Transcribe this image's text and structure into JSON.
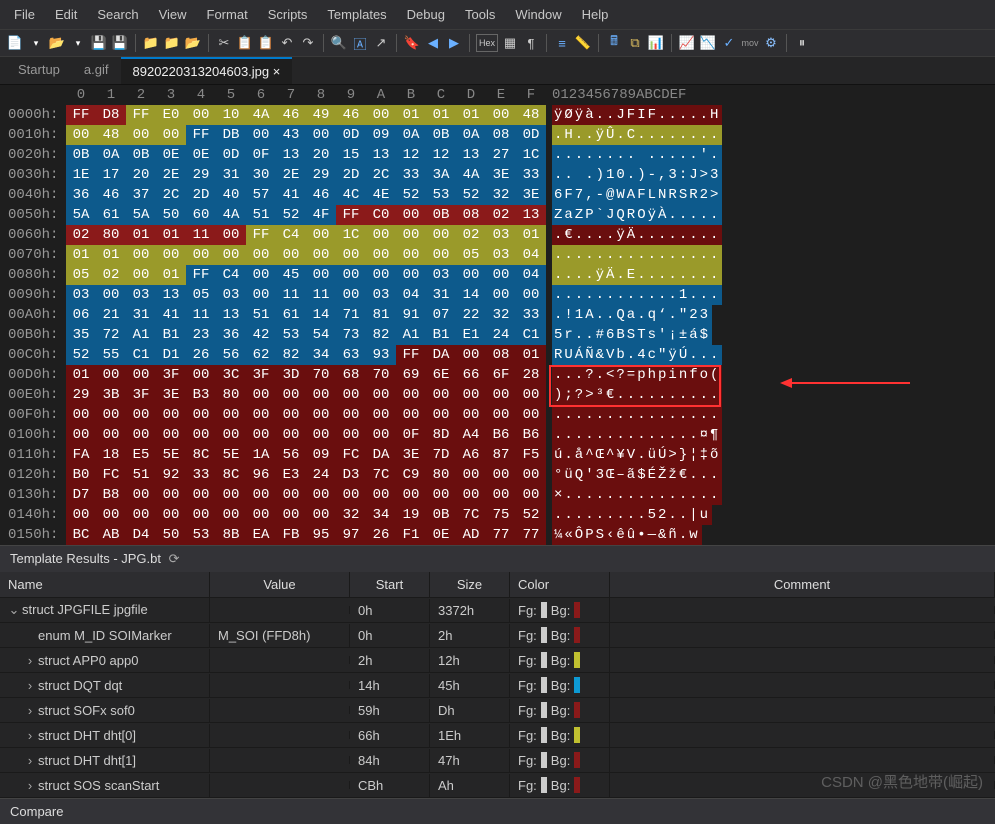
{
  "menu": [
    "File",
    "Edit",
    "Search",
    "View",
    "Format",
    "Scripts",
    "Templates",
    "Debug",
    "Tools",
    "Window",
    "Help"
  ],
  "tabs": [
    {
      "label": "Startup",
      "active": false
    },
    {
      "label": "a.gif",
      "active": false
    },
    {
      "label": "8920220313204603.jpg",
      "active": true
    }
  ],
  "hex": {
    "cols": [
      "0",
      "1",
      "2",
      "3",
      "4",
      "5",
      "6",
      "7",
      "8",
      "9",
      "A",
      "B",
      "C",
      "D",
      "E",
      "F"
    ],
    "ascii_header": "0123456789ABCDEF",
    "rows": [
      {
        "off": "0000h:",
        "b": [
          "FF",
          "D8",
          "FF",
          "E0",
          "00",
          "10",
          "4A",
          "46",
          "49",
          "46",
          "00",
          "01",
          "01",
          "01",
          "00",
          "48"
        ],
        "c": [
          "r",
          "r",
          "o",
          "o",
          "o",
          "o",
          "o",
          "o",
          "o",
          "o",
          "o",
          "o",
          "o",
          "o",
          "o",
          "o"
        ],
        "a": "ÿØÿà..JFIF.....H"
      },
      {
        "off": "0010h:",
        "b": [
          "00",
          "48",
          "00",
          "00",
          "FF",
          "DB",
          "00",
          "43",
          "00",
          "0D",
          "09",
          "0A",
          "0B",
          "0A",
          "08",
          "0D"
        ],
        "c": [
          "o",
          "o",
          "o",
          "o",
          "b",
          "b",
          "b",
          "b",
          "b",
          "b",
          "b",
          "b",
          "b",
          "b",
          "b",
          "b"
        ],
        "a": ".H..ÿÛ.C........"
      },
      {
        "off": "0020h:",
        "b": [
          "0B",
          "0A",
          "0B",
          "0E",
          "0E",
          "0D",
          "0F",
          "13",
          "20",
          "15",
          "13",
          "12",
          "12",
          "13",
          "27",
          "1C"
        ],
        "c": [
          "b",
          "b",
          "b",
          "b",
          "b",
          "b",
          "b",
          "b",
          "b",
          "b",
          "b",
          "b",
          "b",
          "b",
          "b",
          "b"
        ],
        "a": "........ .....'."
      },
      {
        "off": "0030h:",
        "b": [
          "1E",
          "17",
          "20",
          "2E",
          "29",
          "31",
          "30",
          "2E",
          "29",
          "2D",
          "2C",
          "33",
          "3A",
          "4A",
          "3E",
          "33"
        ],
        "c": [
          "b",
          "b",
          "b",
          "b",
          "b",
          "b",
          "b",
          "b",
          "b",
          "b",
          "b",
          "b",
          "b",
          "b",
          "b",
          "b"
        ],
        "a": ".. .)10.)-,3:J>3"
      },
      {
        "off": "0040h:",
        "b": [
          "36",
          "46",
          "37",
          "2C",
          "2D",
          "40",
          "57",
          "41",
          "46",
          "4C",
          "4E",
          "52",
          "53",
          "52",
          "32",
          "3E"
        ],
        "c": [
          "b",
          "b",
          "b",
          "b",
          "b",
          "b",
          "b",
          "b",
          "b",
          "b",
          "b",
          "b",
          "b",
          "b",
          "b",
          "b"
        ],
        "a": "6F7,-@WAFLNRSR2>"
      },
      {
        "off": "0050h:",
        "b": [
          "5A",
          "61",
          "5A",
          "50",
          "60",
          "4A",
          "51",
          "52",
          "4F",
          "FF",
          "C0",
          "00",
          "0B",
          "08",
          "02",
          "13"
        ],
        "c": [
          "b",
          "b",
          "b",
          "b",
          "b",
          "b",
          "b",
          "b",
          "b",
          "r",
          "r",
          "r",
          "r",
          "r",
          "r",
          "r"
        ],
        "a": "ZaZP`JQROÿÀ....."
      },
      {
        "off": "0060h:",
        "b": [
          "02",
          "80",
          "01",
          "01",
          "11",
          "00",
          "FF",
          "C4",
          "00",
          "1C",
          "00",
          "00",
          "00",
          "02",
          "03",
          "01"
        ],
        "c": [
          "r",
          "r",
          "r",
          "r",
          "r",
          "r",
          "o",
          "o",
          "o",
          "o",
          "o",
          "o",
          "o",
          "o",
          "o",
          "o"
        ],
        "a": ".€....ÿÄ........"
      },
      {
        "off": "0070h:",
        "b": [
          "01",
          "01",
          "00",
          "00",
          "00",
          "00",
          "00",
          "00",
          "00",
          "00",
          "00",
          "00",
          "00",
          "05",
          "03",
          "04"
        ],
        "c": [
          "o",
          "o",
          "o",
          "o",
          "o",
          "o",
          "o",
          "o",
          "o",
          "o",
          "o",
          "o",
          "o",
          "o",
          "o",
          "o"
        ],
        "a": "................"
      },
      {
        "off": "0080h:",
        "b": [
          "05",
          "02",
          "00",
          "01",
          "FF",
          "C4",
          "00",
          "45",
          "00",
          "00",
          "00",
          "00",
          "03",
          "00",
          "00",
          "04"
        ],
        "c": [
          "o",
          "o",
          "o",
          "o",
          "b",
          "b",
          "b",
          "b",
          "b",
          "b",
          "b",
          "b",
          "b",
          "b",
          "b",
          "b"
        ],
        "a": "....ÿÄ.E........"
      },
      {
        "off": "0090h:",
        "b": [
          "03",
          "00",
          "03",
          "13",
          "05",
          "03",
          "00",
          "11",
          "11",
          "00",
          "03",
          "04",
          "31",
          "14",
          "00",
          "00"
        ],
        "c": [
          "b",
          "b",
          "b",
          "b",
          "b",
          "b",
          "b",
          "b",
          "b",
          "b",
          "b",
          "b",
          "b",
          "b",
          "b",
          "b"
        ],
        "a": "............1..."
      },
      {
        "off": "00A0h:",
        "b": [
          "06",
          "21",
          "31",
          "41",
          "11",
          "13",
          "51",
          "61",
          "14",
          "71",
          "81",
          "91",
          "07",
          "22",
          "32",
          "33"
        ],
        "c": [
          "b",
          "b",
          "b",
          "b",
          "b",
          "b",
          "b",
          "b",
          "b",
          "b",
          "b",
          "b",
          "b",
          "b",
          "b",
          "b"
        ],
        "a": ".!1A..Qa.q‘.\"23"
      },
      {
        "off": "00B0h:",
        "b": [
          "35",
          "72",
          "A1",
          "B1",
          "23",
          "36",
          "42",
          "53",
          "54",
          "73",
          "82",
          "A1",
          "B1",
          "E1",
          "24",
          "C1"
        ],
        "c": [
          "b",
          "b",
          "b",
          "b",
          "b",
          "b",
          "b",
          "b",
          "b",
          "b",
          "b",
          "b",
          "b",
          "b",
          "b",
          "b"
        ],
        "a": "5r..#6BSTs'¡±á$"
      },
      {
        "off": "00C0h:",
        "b": [
          "52",
          "55",
          "C1",
          "D1",
          "26",
          "56",
          "62",
          "82",
          "34",
          "63",
          "93",
          "FF",
          "DA",
          "00",
          "08",
          "01"
        ],
        "c": [
          "b",
          "b",
          "b",
          "b",
          "b",
          "b",
          "b",
          "b",
          "b",
          "b",
          "b",
          "d",
          "d",
          "d",
          "d",
          "d"
        ],
        "a": "RUÁÑ&Vb.4c\"ÿÚ..."
      },
      {
        "off": "00D0h:",
        "b": [
          "01",
          "00",
          "00",
          "3F",
          "00",
          "3C",
          "3F",
          "3D",
          "70",
          "68",
          "70",
          "69",
          "6E",
          "66",
          "6F",
          "28"
        ],
        "c": [
          "d",
          "d",
          "d",
          "d",
          "d",
          "d",
          "d",
          "d",
          "d",
          "d",
          "d",
          "d",
          "d",
          "d",
          "d",
          "d"
        ],
        "a": "...?.<?=phpinfo("
      },
      {
        "off": "00E0h:",
        "b": [
          "29",
          "3B",
          "3F",
          "3E",
          "B3",
          "80",
          "00",
          "00",
          "00",
          "00",
          "00",
          "00",
          "00",
          "00",
          "00",
          "00"
        ],
        "c": [
          "d",
          "d",
          "d",
          "d",
          "d",
          "d",
          "d",
          "d",
          "d",
          "d",
          "d",
          "d",
          "d",
          "d",
          "d",
          "d"
        ],
        "a": ");?>³€.........."
      },
      {
        "off": "00F0h:",
        "b": [
          "00",
          "00",
          "00",
          "00",
          "00",
          "00",
          "00",
          "00",
          "00",
          "00",
          "00",
          "00",
          "00",
          "00",
          "00",
          "00"
        ],
        "c": [
          "d",
          "d",
          "d",
          "d",
          "d",
          "d",
          "d",
          "d",
          "d",
          "d",
          "d",
          "d",
          "d",
          "d",
          "d",
          "d"
        ],
        "a": "................"
      },
      {
        "off": "0100h:",
        "b": [
          "00",
          "00",
          "00",
          "00",
          "00",
          "00",
          "00",
          "00",
          "00",
          "00",
          "00",
          "0F",
          "8D",
          "A4",
          "B6",
          "B6"
        ],
        "c": [
          "d",
          "d",
          "d",
          "d",
          "d",
          "d",
          "d",
          "d",
          "d",
          "d",
          "d",
          "d",
          "d",
          "d",
          "d",
          "d"
        ],
        "a": "..............¤¶"
      },
      {
        "off": "0110h:",
        "b": [
          "FA",
          "18",
          "E5",
          "5E",
          "8C",
          "5E",
          "1A",
          "56",
          "09",
          "FC",
          "DA",
          "3E",
          "7D",
          "A6",
          "87",
          "F5"
        ],
        "c": [
          "d",
          "d",
          "d",
          "d",
          "d",
          "d",
          "d",
          "d",
          "d",
          "d",
          "d",
          "d",
          "d",
          "d",
          "d",
          "d"
        ],
        "a": "ú.å^Œ^¥V.üÚ>}¦‡õ"
      },
      {
        "off": "0120h:",
        "b": [
          "B0",
          "FC",
          "51",
          "92",
          "33",
          "8C",
          "96",
          "E3",
          "24",
          "D3",
          "7C",
          "C9",
          "80",
          "00",
          "00",
          "00"
        ],
        "c": [
          "d",
          "d",
          "d",
          "d",
          "d",
          "d",
          "d",
          "d",
          "d",
          "d",
          "d",
          "d",
          "d",
          "d",
          "d",
          "d"
        ],
        "a": "°üQ'3Œ–ã$ÉŽž€..."
      },
      {
        "off": "0130h:",
        "b": [
          "D7",
          "B8",
          "00",
          "00",
          "00",
          "00",
          "00",
          "00",
          "00",
          "00",
          "00",
          "00",
          "00",
          "00",
          "00",
          "00"
        ],
        "c": [
          "d",
          "d",
          "d",
          "d",
          "d",
          "d",
          "d",
          "d",
          "d",
          "d",
          "d",
          "d",
          "d",
          "d",
          "d",
          "d"
        ],
        "a": "×..............."
      },
      {
        "off": "0140h:",
        "b": [
          "00",
          "00",
          "00",
          "00",
          "00",
          "00",
          "00",
          "00",
          "00",
          "32",
          "34",
          "19",
          "0B",
          "7C",
          "75",
          "52"
        ],
        "c": [
          "d",
          "d",
          "d",
          "d",
          "d",
          "d",
          "d",
          "d",
          "d",
          "d",
          "d",
          "d",
          "d",
          "d",
          "d",
          "d"
        ],
        "a": ".........52..|u"
      },
      {
        "off": "0150h:",
        "b": [
          "BC",
          "AB",
          "D4",
          "50",
          "53",
          "8B",
          "EA",
          "FB",
          "95",
          "97",
          "26",
          "F1",
          "0E",
          "AD",
          "77",
          "77"
        ],
        "c": [
          "d",
          "d",
          "d",
          "d",
          "d",
          "d",
          "d",
          "d",
          "d",
          "d",
          "d",
          "d",
          "d",
          "d",
          "d",
          "d"
        ],
        "a": "¼«ÔPS‹êû•—&ñ.­w"
      }
    ]
  },
  "panel_title": "Template Results - JPG.bt",
  "table": {
    "headers": [
      "Name",
      "Value",
      "Start",
      "Size",
      "Color",
      "Comment"
    ],
    "fg_label": "Fg:",
    "bg_label": "Bg:",
    "rows": [
      {
        "name": "struct JPGFILE jpgfile",
        "value": "",
        "start": "0h",
        "size": "3372h",
        "fg": "#ccc",
        "bg": "#8b1a1a",
        "exp": "v",
        "indent": 0
      },
      {
        "name": "enum M_ID SOIMarker",
        "value": "M_SOI (FFD8h)",
        "start": "0h",
        "size": "2h",
        "fg": "#ccc",
        "bg": "#8b1a1a",
        "exp": "",
        "indent": 1
      },
      {
        "name": "struct APP0 app0",
        "value": "",
        "start": "2h",
        "size": "12h",
        "fg": "#ccc",
        "bg": "#c0c030",
        "exp": ">",
        "indent": 1
      },
      {
        "name": "struct DQT dqt",
        "value": "",
        "start": "14h",
        "size": "45h",
        "fg": "#ccc",
        "bg": "#0d9ad4",
        "exp": ">",
        "indent": 1
      },
      {
        "name": "struct SOFx sof0",
        "value": "",
        "start": "59h",
        "size": "Dh",
        "fg": "#ccc",
        "bg": "#8b1a1a",
        "exp": ">",
        "indent": 1
      },
      {
        "name": "struct DHT dht[0]",
        "value": "",
        "start": "66h",
        "size": "1Eh",
        "fg": "#ccc",
        "bg": "#c0c030",
        "exp": ">",
        "indent": 1
      },
      {
        "name": "struct DHT dht[1]",
        "value": "",
        "start": "84h",
        "size": "47h",
        "fg": "#ccc",
        "bg": "#8b1a1a",
        "exp": ">",
        "indent": 1
      },
      {
        "name": "struct SOS scanStart",
        "value": "",
        "start": "CBh",
        "size": "Ah",
        "fg": "#ccc",
        "bg": "#8b1a1a",
        "exp": ">",
        "indent": 1
      }
    ]
  },
  "footer_tab": "Compare",
  "watermark": "CSDN @黑色地带(崛起)"
}
